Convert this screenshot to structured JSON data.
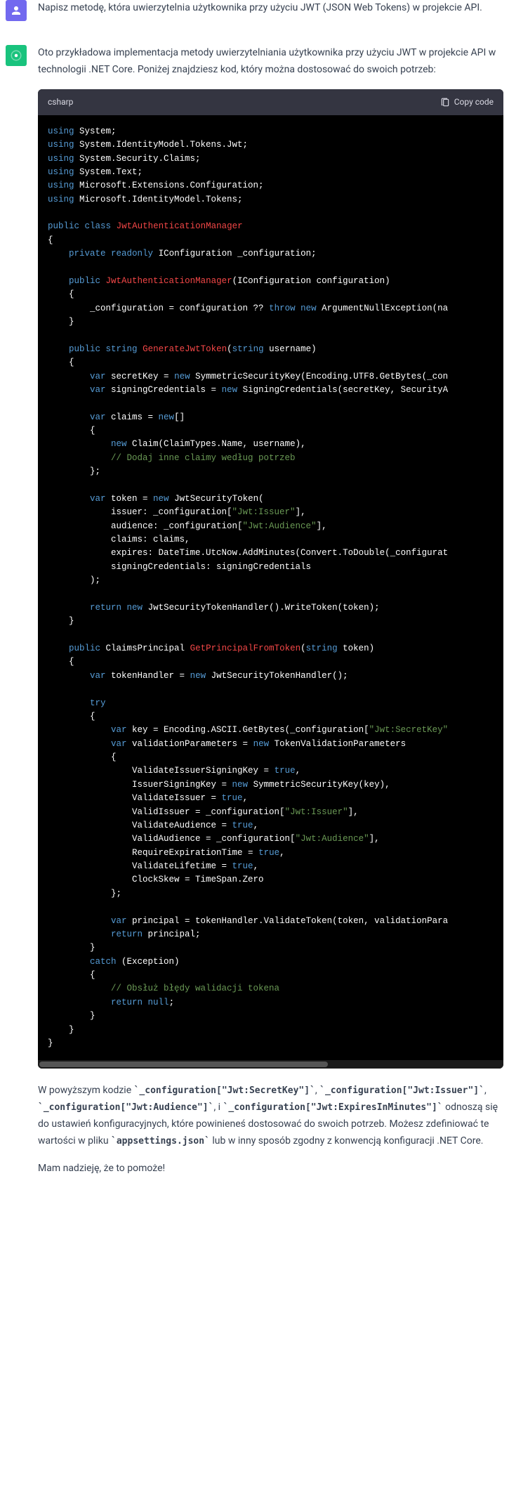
{
  "user_message": "Napisz metodę, która uwierzytelnia użytkownika przy użyciu JWT (JSON Web Tokens) w projekcie API.",
  "assistant_intro": "Oto przykładowa implementacja metody uwierzytelniania użytkownika przy użyciu JWT w projekcie API w technologii .NET Core. Poniżej znajdziesz kod, który można dostosować do swoich potrzeb:",
  "code_lang": "csharp",
  "copy_label": "Copy code",
  "outro_pre": "W powyższym kodzie ",
  "cfg1": "`_configuration[\"Jwt:SecretKey\"]`",
  "sep1": ", ",
  "cfg2": "`_configuration[\"Jwt:Issuer\"]`",
  "sep2": ", ",
  "cfg3": "`_configuration[\"Jwt:Audience\"]`",
  "sep3": ", i ",
  "cfg4": "`_configuration[\"Jwt:ExpiresInMinutes\"]`",
  "outro_mid": " odnoszą się do ustawień konfiguracyjnych, które powinieneś dostosować do swoich potrzeb. Możesz zdefiniować te wartości w pliku ",
  "cfg5": "`appsettings.json`",
  "outro_end": " lub w inny sposób zgodny z konwencją konfiguracji .NET Core.",
  "closing": "Mam nadzieję, że to pomoże!"
}
